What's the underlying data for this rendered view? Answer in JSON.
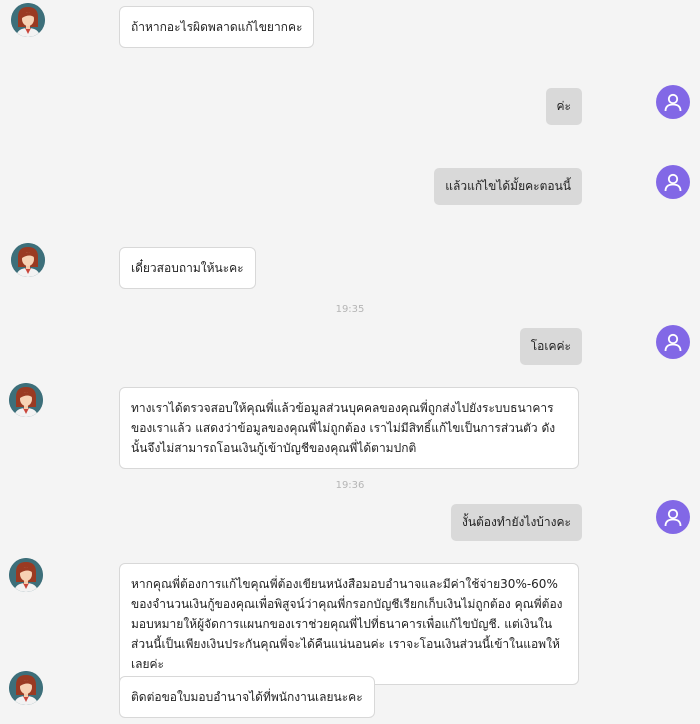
{
  "chat": {
    "messages": [
      {
        "text": "ถ้าหากอะไรผิดพลาดแก้ไขยากคะ"
      },
      {
        "text": "ค่ะ"
      },
      {
        "text": "แล้วแก้ไขได้มั้ยคะตอนนี้"
      },
      {
        "text": "เดี๋ยวสอบถามให้นะคะ"
      },
      {
        "text": "19:35"
      },
      {
        "text": "โอเคค่ะ"
      },
      {
        "text": "ทางเราได้ตรวจสอบให้คุณพี่แล้วข้อมูลส่วนบุคคลของคุณพี่ถูกส่งไปยังระบบธนาคารของเราแล้ว แสดงว่าข้อมูลของคุณพี่ไม่ถูกต้อง เราไม่มีสิทธิ์แก้ไขเป็นการส่วนตัว ดังนั้นจึงไม่สามารถโอนเงินกู้เข้าบัญชีของคุณพี่ได้ตามปกติ"
      },
      {
        "text": "19:36"
      },
      {
        "text": "งั้นต้องทำยังไงบ้างคะ"
      },
      {
        "text": "หากคุณพี่ต้องการแก้ไขคุณพี่ต้องเขียนหนังสือมอบอำนาจและมีค่าใช้จ่าย30%-60% ของจำนวนเงินกู้ของคุณเพื่อพิสูจน์ว่าคุณพี่กรอกบัญชีเรียกเก็บเงินไม่ถูกต้อง คุณพี่ต้องมอบหมายให้ผู้จัดการแผนกของเราช่วยคุณพี่ไปที่ธนาคารเพื่อแก้ไขบัญชี. แต่เงินในส่วนนี้เป็นเพียงเงินประกันคุณพี่จะได้คืนแน่นอนค่ะ เราจะโอนเงินส่วนนี้เข้าในแอพให้เลยค่ะ"
      },
      {
        "text": "ติดต่อขอใบมอบอำนาจได้ที่พนักงานเลยนะคะ"
      }
    ]
  },
  "icons": {
    "agent_avatar": "woman-avatar-icon",
    "user_avatar": "user-icon"
  },
  "colors": {
    "user_avatar": "#8268e6",
    "agent_avatar_bg": "#3d6f7a",
    "user_bubble": "#d9d9d9",
    "agent_bubble": "#ffffff"
  }
}
